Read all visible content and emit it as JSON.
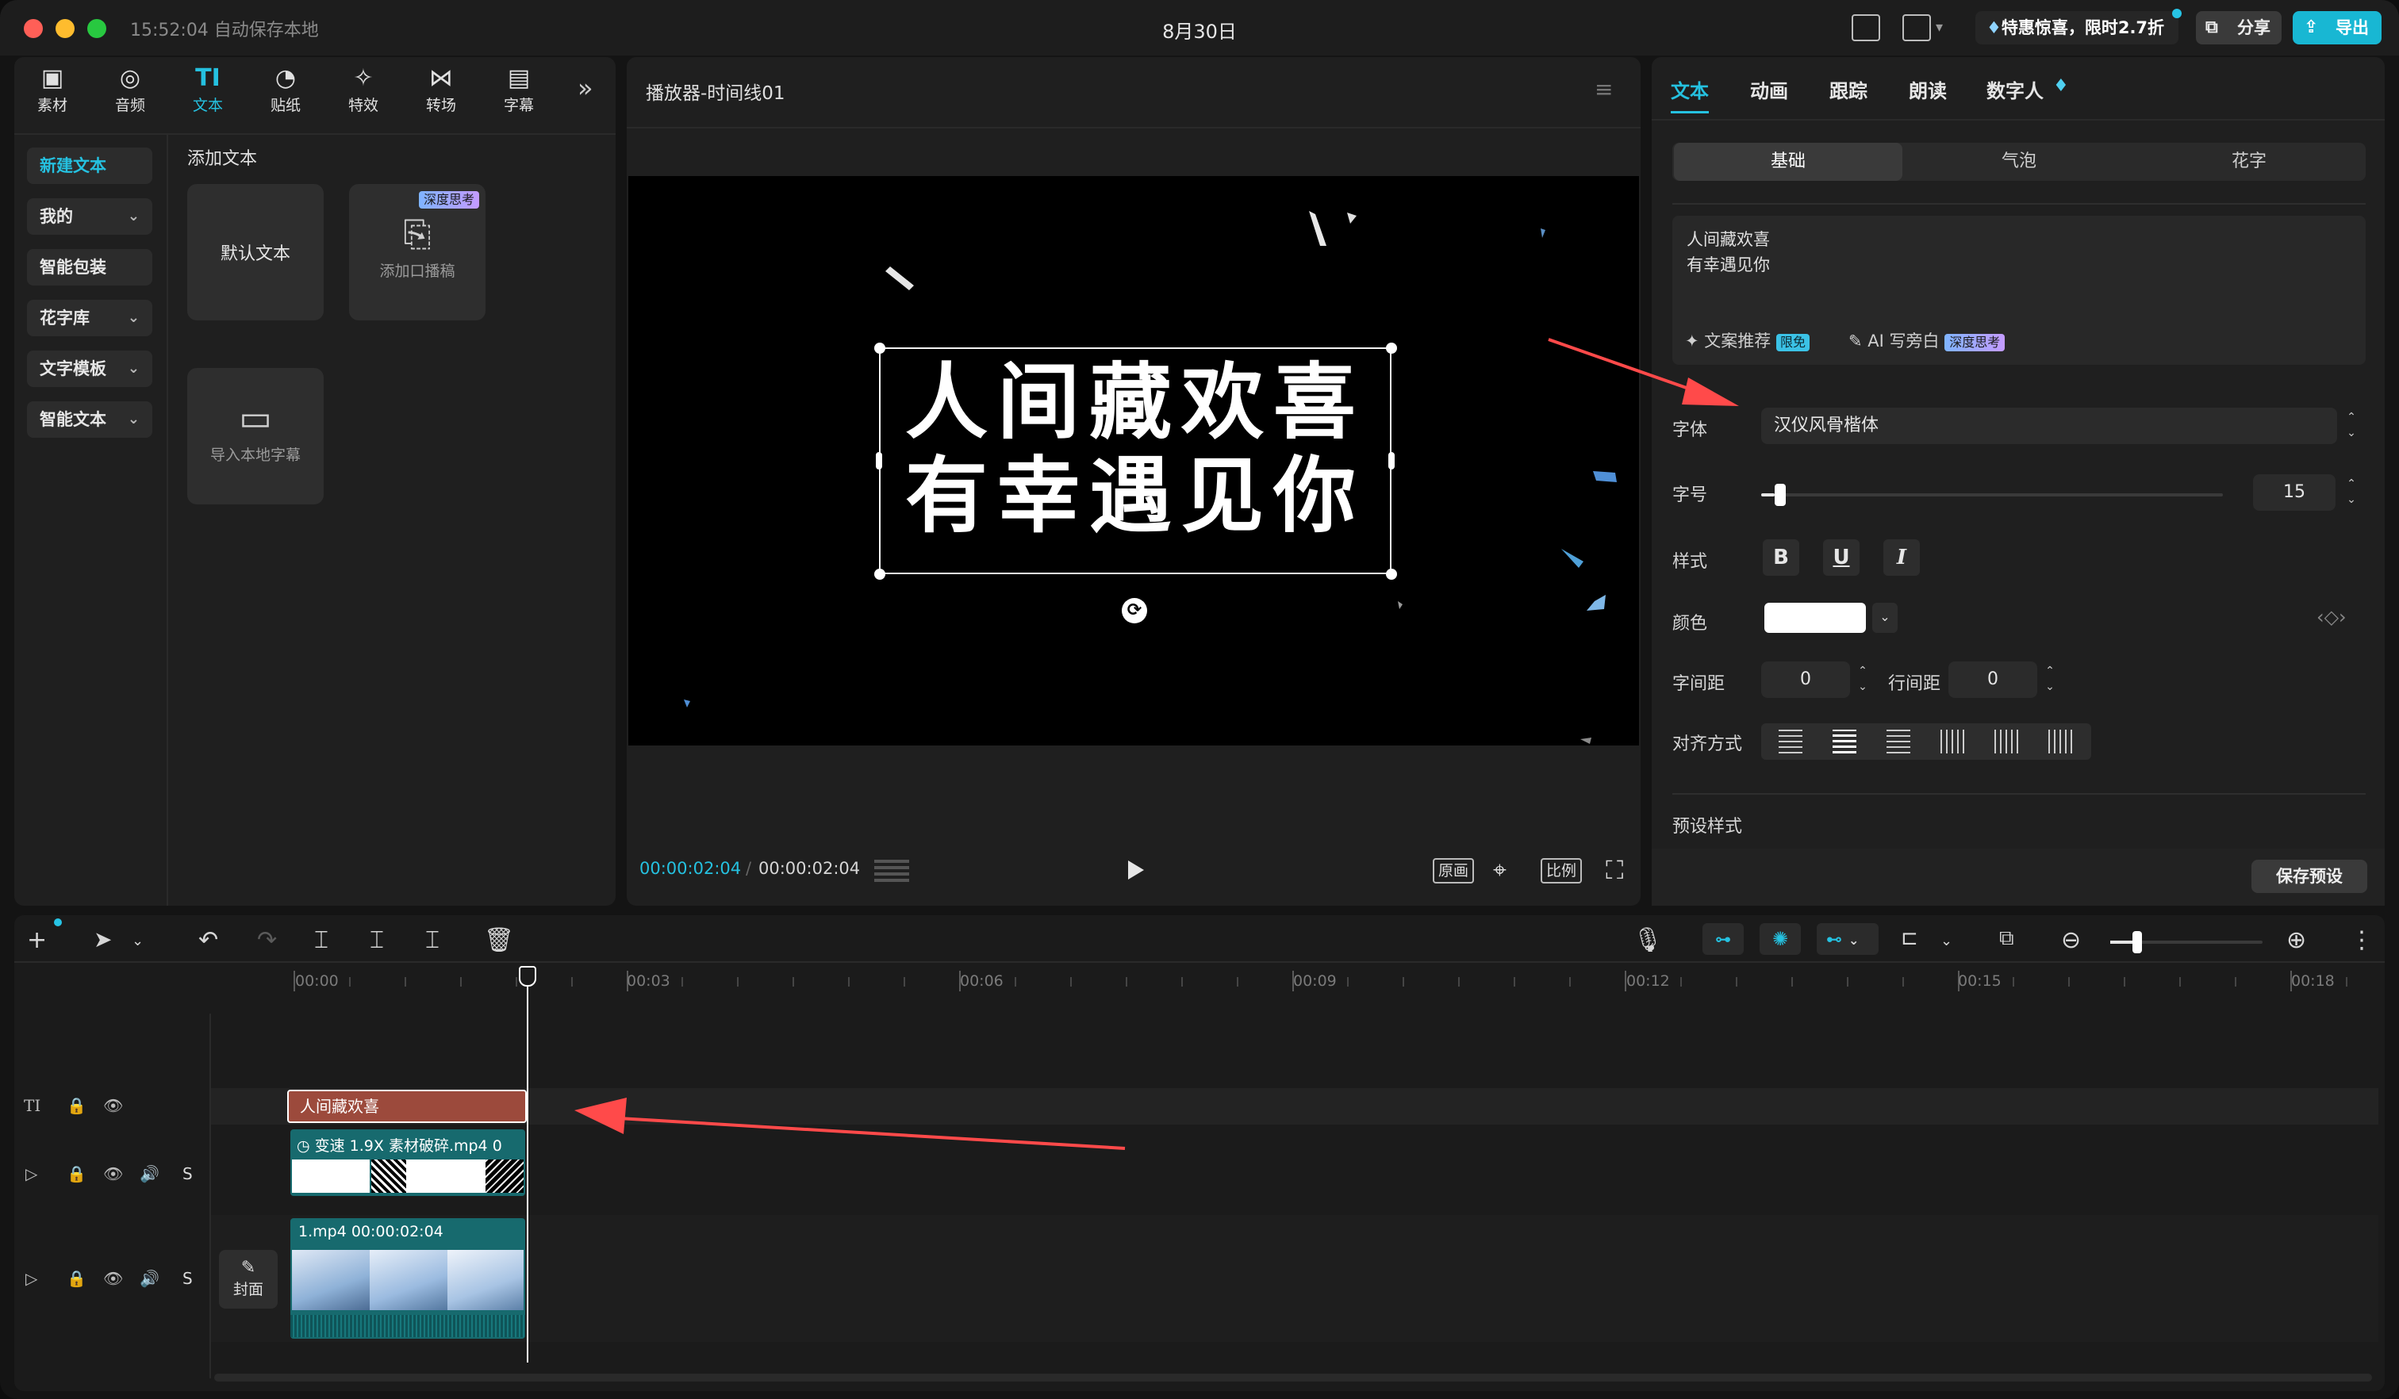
{
  "titlebar": {
    "time": "15:52:04 自动保存本地",
    "title": "8月30日",
    "promo": "特惠惊喜，限时2.7折",
    "share": "分享",
    "export": "导出"
  },
  "toolbar": [
    {
      "label": "素材",
      "icon": "media-icon"
    },
    {
      "label": "音频",
      "icon": "audio-icon"
    },
    {
      "label": "文本",
      "icon": "text-icon",
      "active": true
    },
    {
      "label": "贴纸",
      "icon": "sticker-icon"
    },
    {
      "label": "特效",
      "icon": "effects-icon"
    },
    {
      "label": "转场",
      "icon": "transition-icon"
    },
    {
      "label": "字幕",
      "icon": "subtitle-icon"
    }
  ],
  "sidebar": {
    "items": [
      {
        "label": "新建文本"
      },
      {
        "label": "我的"
      },
      {
        "label": "智能包装"
      },
      {
        "label": "花字库"
      },
      {
        "label": "文字模板"
      },
      {
        "label": "智能文本"
      }
    ]
  },
  "library": {
    "heading": "添加文本",
    "cards": [
      {
        "label": "默认文本"
      },
      {
        "label": "添加口播稿",
        "badge": "深度思考"
      },
      {
        "label": "导入本地字幕"
      }
    ]
  },
  "player": {
    "title": "播放器-时间线01",
    "line1": "人间藏欢喜",
    "line2": "有幸遇见你",
    "current_time": "00:00:02:04",
    "total_time": "00:00:02:04",
    "btn_original": "原画",
    "btn_ratio": "比例"
  },
  "inspector": {
    "tabs": [
      "文本",
      "动画",
      "跟踪",
      "朗读",
      "数字人"
    ],
    "segments": [
      "基础",
      "气泡",
      "花字"
    ],
    "text_content_line1": "人间藏欢喜",
    "text_content_line2": "有幸遇见你",
    "copy_recommend": "文案推荐",
    "copy_badge": "限免",
    "ai_narration": "AI 写旁白",
    "ai_badge": "深度思考",
    "font_label": "字体",
    "font_value": "汉仪风骨楷体",
    "size_label": "字号",
    "size_value": "15",
    "size_fraction": 0.03,
    "style_label": "样式",
    "bold": "B",
    "underline": "U",
    "italic": "I",
    "color_label": "颜色",
    "color_value": "#ffffff",
    "letter_spacing_label": "字间距",
    "letter_spacing_value": "0",
    "line_spacing_label": "行间距",
    "line_spacing_value": "0",
    "align_label": "对齐方式",
    "preset_label": "预设样式",
    "save_preset": "保存预设"
  },
  "timeline": {
    "ruler": [
      "00:00",
      "00:03",
      "00:06",
      "00:09",
      "00:12",
      "00:15",
      "00:18"
    ],
    "text_clip": "人间藏欢喜",
    "effect_clip_speed": "变速 1.9X",
    "effect_clip_name": "素材破碎.mp4",
    "effect_clip_tail": "0",
    "main_clip_name": "1.mp4",
    "main_clip_duration": "00:00:02:04",
    "cover_label": "封面",
    "mute_label": "S"
  },
  "colors": {
    "accent": "#25c1e0",
    "text_clip": "#9c4a3c",
    "video_clip": "#176a6e",
    "arrow": "#ff4a4a"
  }
}
